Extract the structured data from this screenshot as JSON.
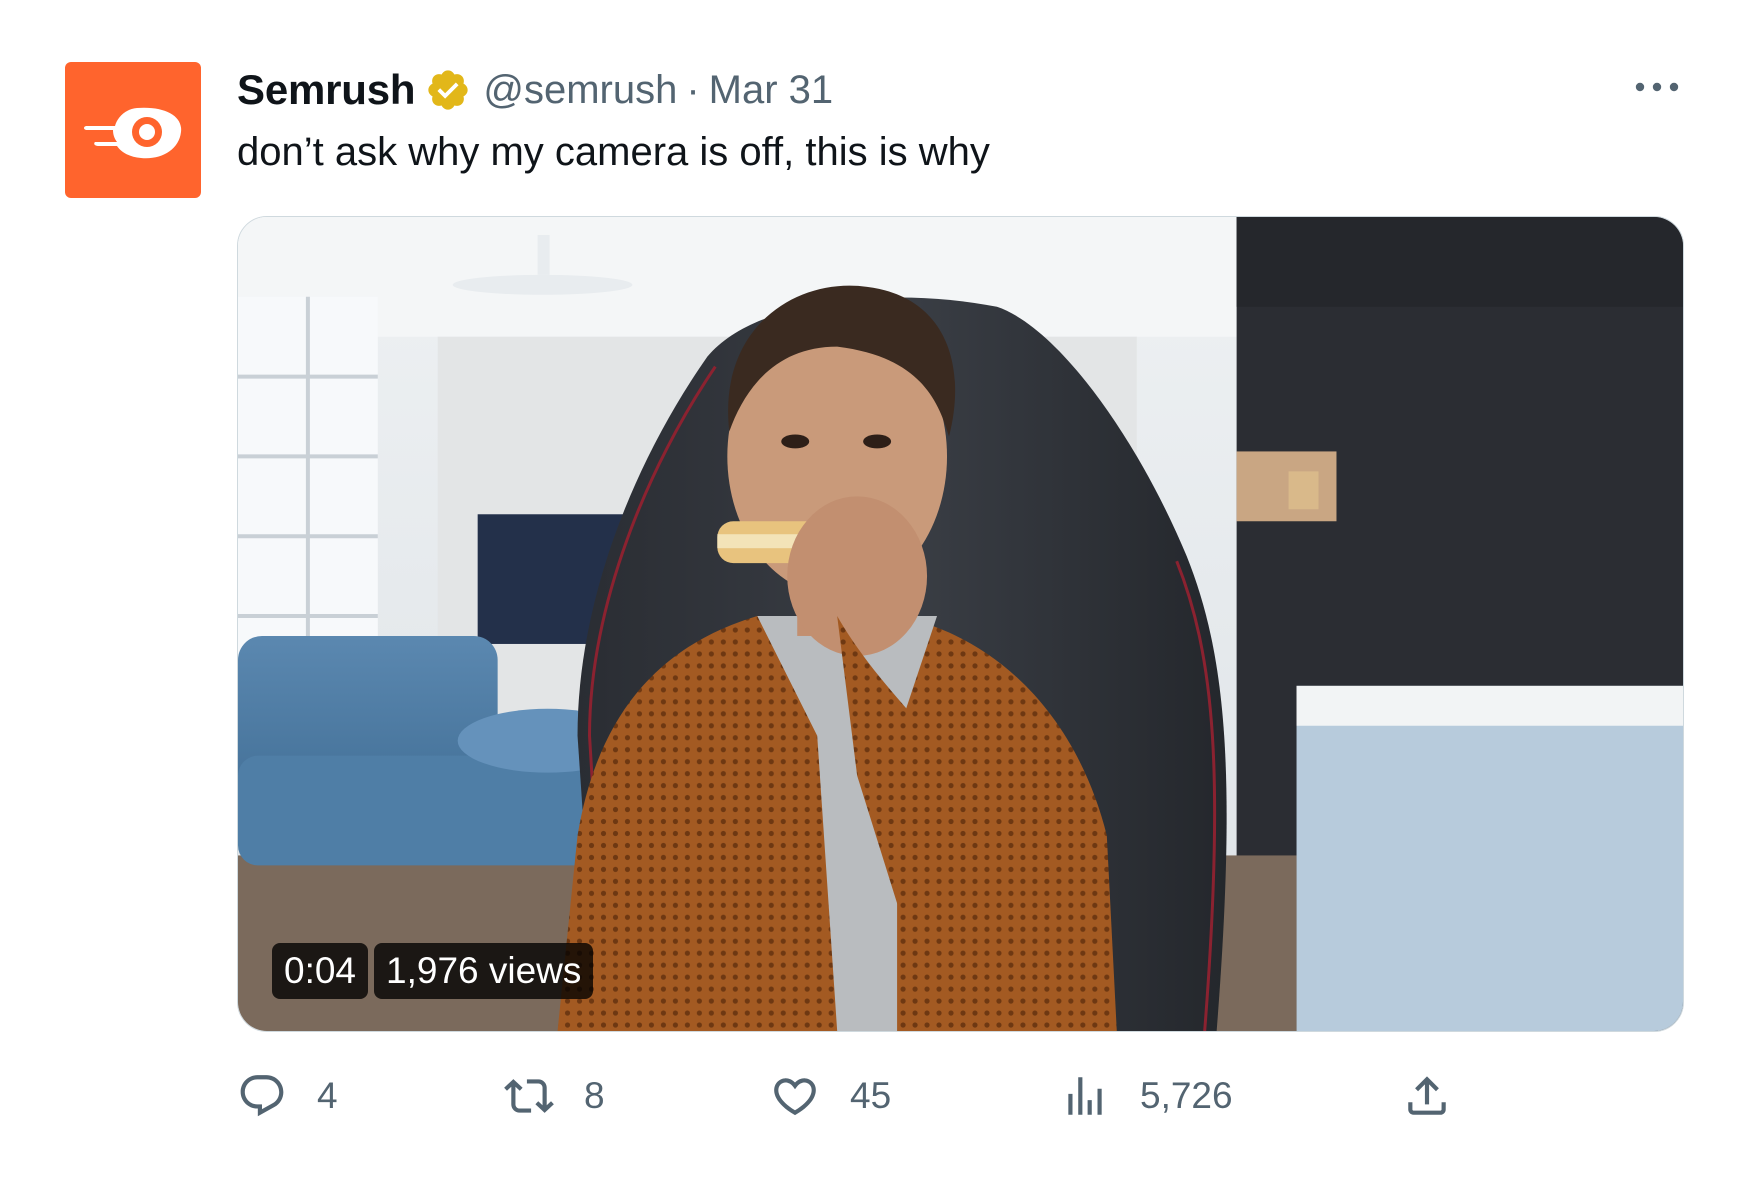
{
  "tweet": {
    "author_name": "Semrush",
    "handle": "@semrush",
    "separator": "·",
    "date": "Mar 31",
    "text": "don’t ask why my camera is off, this is why"
  },
  "video": {
    "time": "0:04",
    "views": "1,976 views"
  },
  "actions": {
    "replies": "4",
    "reposts": "8",
    "likes": "45",
    "views": "5,726"
  },
  "icons": {
    "avatar": "semrush-logo",
    "verified": "verified-badge-icon",
    "more": "more-icon",
    "reply": "reply-icon",
    "repost": "repost-icon",
    "like": "heart-icon",
    "views": "views-chart-icon",
    "share": "share-icon"
  },
  "colors": {
    "brand": "#FF642D",
    "verified_gold": "#E2B719",
    "secondary_text": "#536471",
    "primary_text": "#0F1419"
  }
}
